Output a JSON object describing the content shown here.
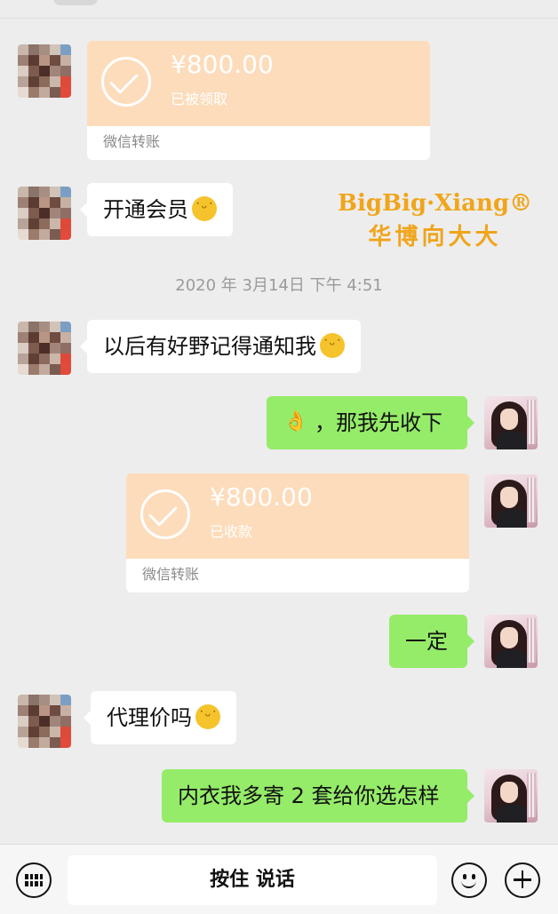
{
  "chat": {
    "timestamp": "2020 年 3月14日  下午 4:51",
    "transfers": [
      {
        "amount": "¥800.00",
        "status": "已被领取",
        "footer": "微信转账"
      },
      {
        "amount": "¥800.00",
        "status": "已收款",
        "footer": "微信转账"
      }
    ],
    "messages": [
      {
        "text": "开通会员"
      },
      {
        "text": "以后有好野记得通知我"
      },
      {
        "text": "，那我先收下"
      },
      {
        "text": "一定"
      },
      {
        "text": "代理价吗"
      },
      {
        "text": "内衣我多寄 2 套给你选怎样"
      }
    ]
  },
  "watermark": {
    "en": "BigBig·Xiang®",
    "zh": "华博向大大"
  },
  "input_bar": {
    "hold_to_talk": "按住 说话"
  },
  "icons": [
    "keyboard-icon",
    "emoji-icon",
    "plus-icon",
    "think-emoji",
    "ok-hand-emoji",
    "checkmark-icon"
  ],
  "colors": {
    "background": "#ededed",
    "bubble_me": "#95ec69",
    "bubble_other": "#ffffff",
    "transfer": "#fddcbb"
  }
}
